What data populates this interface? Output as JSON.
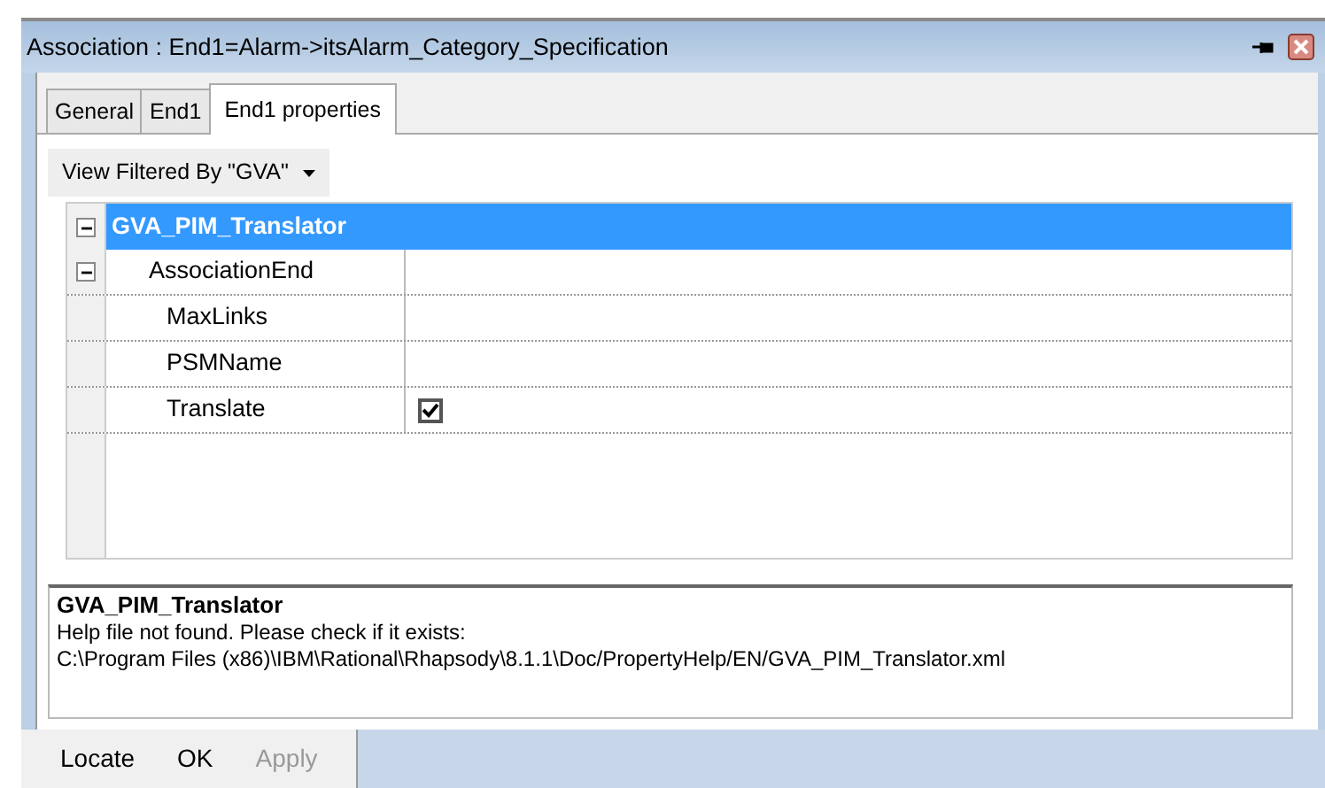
{
  "window": {
    "title": "Association : End1=Alarm->itsAlarm_Category_Specification"
  },
  "tabs": [
    {
      "label": "General",
      "selected": false
    },
    {
      "label": "End1",
      "selected": false
    },
    {
      "label": "End1 properties",
      "selected": true
    }
  ],
  "filter": {
    "label": "View Filtered By \"GVA\""
  },
  "tree": [
    {
      "label": "GVA_PIM_Translator",
      "expanded": true,
      "selected": true,
      "children": [
        {
          "label": "AssociationEnd",
          "expanded": true,
          "selected": false,
          "children": [
            {
              "label": "MaxLinks",
              "kind": "text",
              "selected": false
            },
            {
              "label": "PSMName",
              "kind": "text",
              "selected": false
            },
            {
              "label": "Translate",
              "kind": "checkbox",
              "checked": true,
              "selected": false
            }
          ]
        }
      ]
    }
  ],
  "help": {
    "title": "GVA_PIM_Translator",
    "lines": [
      "Help file not found. Please check if it exists:",
      "C:\\Program Files (x86)\\IBM\\Rational\\Rhapsody\\8.1.1\\Doc/PropertyHelp/EN/GVA_PIM_Translator.xml"
    ]
  },
  "buttons": [
    {
      "label": "Locate",
      "disabled": false
    },
    {
      "label": "OK",
      "disabled": false
    },
    {
      "label": "Apply",
      "disabled": true
    }
  ]
}
